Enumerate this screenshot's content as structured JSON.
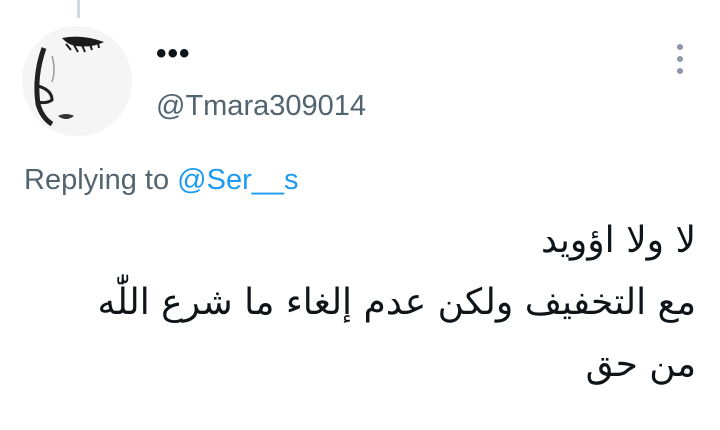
{
  "tweet": {
    "author": {
      "display_name": "•••",
      "handle": "@Tmara309014",
      "avatar_icon": "profile-avatar-sketch"
    },
    "more_icon": "more-vertical-icon",
    "reply_context": {
      "prefix": "Replying to ",
      "mention": "@Ser__s"
    },
    "text_lines": [
      "لا ولا اؤويد",
      "مع التخفيف ولكن عدم إلغاء ما شرع اللّٰه",
      "من حق"
    ]
  },
  "colors": {
    "text": "#0f1419",
    "secondary": "#536471",
    "link": "#1d9bf0",
    "thread_line": "#cfd9de"
  }
}
